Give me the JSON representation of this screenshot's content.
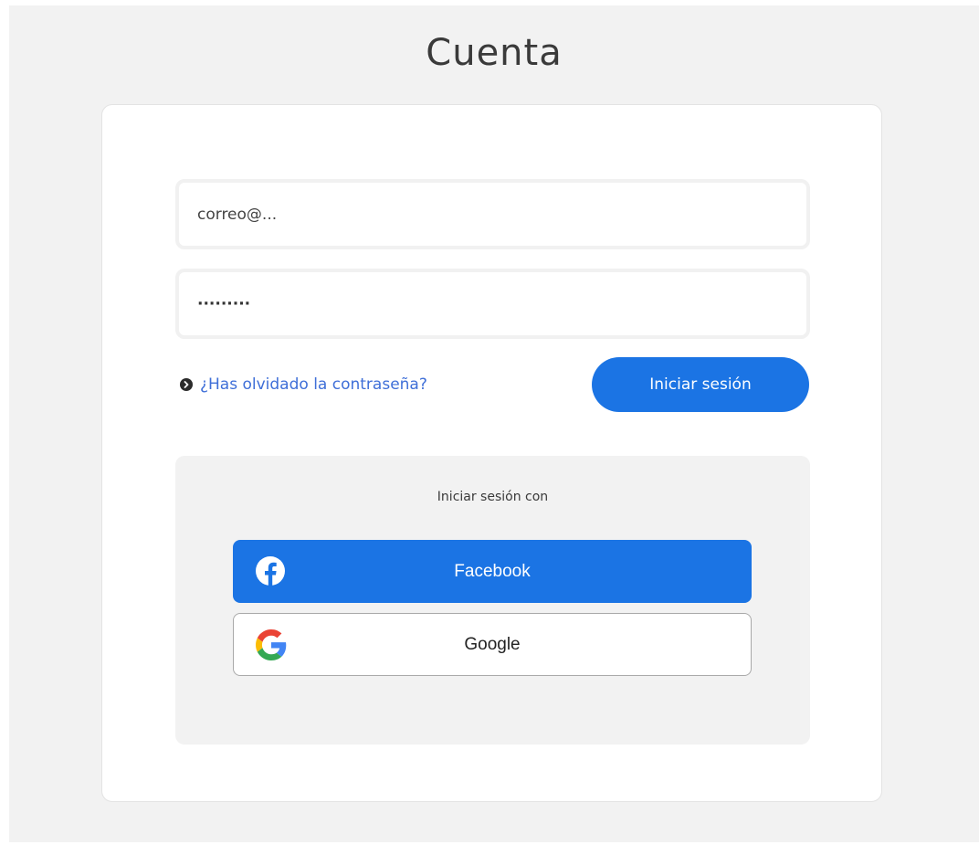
{
  "page": {
    "title": "Cuenta"
  },
  "form": {
    "email_placeholder": "correo@...",
    "password_value": "·········",
    "forgot_link": "¿Has olvidado la contraseña?",
    "login_button": "Iniciar sesión"
  },
  "social": {
    "caption": "Iniciar sesión con",
    "facebook_label": "Facebook",
    "google_label": "Google",
    "facebook_icon": "facebook-icon",
    "google_icon": "google-icon"
  },
  "colors": {
    "accent": "#1b74e4",
    "link": "#3f6fd8",
    "background": "#f2f2f2"
  }
}
